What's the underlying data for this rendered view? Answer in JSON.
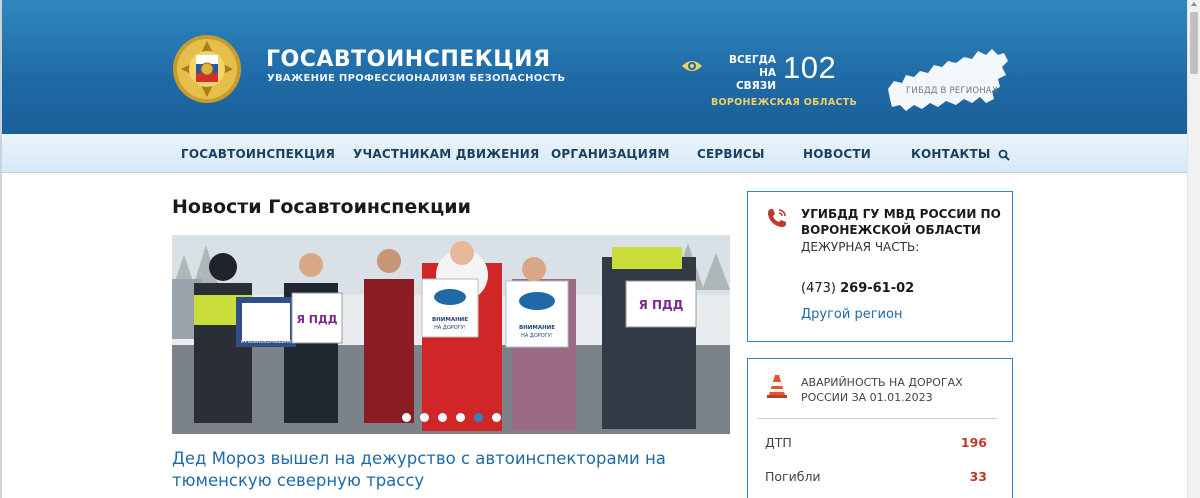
{
  "header": {
    "brand_title": "ГОСАВТОИНСПЕКЦИЯ",
    "brand_subtitle": "УВАЖЕНИЕ ПРОФЕССИОНАЛИЗМ БЕЗОПАСНОСТЬ",
    "always_line1": "ВСЕГДА",
    "always_line2": "НА СВЯЗИ",
    "phone": "102",
    "region": "ВОРОНЕЖСКАЯ ОБЛАСТЬ",
    "map_label": "ГИБДД В РЕГИОНАХ"
  },
  "nav": {
    "items": [
      {
        "label": "ГОСАВТОИНСПЕКЦИЯ"
      },
      {
        "label": "УЧАСТНИКАМ ДВИЖЕНИЯ"
      },
      {
        "label": "ОРГАНИЗАЦИЯМ"
      },
      {
        "label": "СЕРВИСЫ"
      },
      {
        "label": "НОВОСТИ"
      },
      {
        "label": "КОНТАКТЫ"
      }
    ]
  },
  "main": {
    "title": "Новости Госавтоинспекции",
    "slider": {
      "dot_count": 6,
      "active_dot_index": 4,
      "sign_ya_pdd": "Я ПДД",
      "sign_vnimanie_1": "ВНИМАНИЕ",
      "sign_vnimanie_2": "НА ДОРОГУ!",
      "sign_kid_caption": "#РебенокВМашине"
    },
    "headline": "Дед Мороз вышел на дежурство с автоинспекторами на тюменскую северную трассу"
  },
  "sidebar": {
    "contact": {
      "department": "УГИБДД ГУ МВД РОССИИ ПО ВОРОНЕЖСКОЙ ОБЛАСТИ",
      "duty_label": "ДЕЖУРНАЯ ЧАСТЬ:",
      "phone_code": "(473)",
      "phone_number": "269-61-02",
      "other_region": "Другой регион"
    },
    "stats": {
      "title": "АВАРИЙНОСТЬ НА ДОРОГАХ РОССИИ ЗА 01.01.2023",
      "rows": [
        {
          "label": "ДТП",
          "value": "196"
        },
        {
          "label": "Погибли",
          "value": "33"
        }
      ]
    }
  },
  "colors": {
    "header_blue": "#1f6aa6",
    "accent_gold": "#f0cf6a",
    "link_blue": "#1f6aa6",
    "stat_red": "#c0392b"
  }
}
